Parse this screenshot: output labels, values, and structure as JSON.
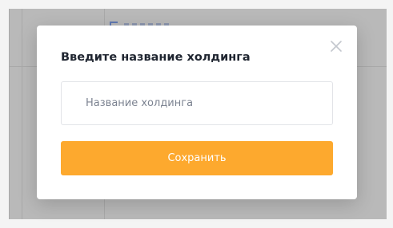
{
  "modal": {
    "title": "Введите название холдинга",
    "input": {
      "value": "",
      "placeholder": "Название холдинга"
    },
    "save_label": "Сохранить",
    "close_icon": "close-icon"
  },
  "colors": {
    "accent": "#fda92e",
    "overlay": "#b9b9b9",
    "title": "#1f2530",
    "placeholder": "#7c8391",
    "border": "#e2e4e8"
  }
}
